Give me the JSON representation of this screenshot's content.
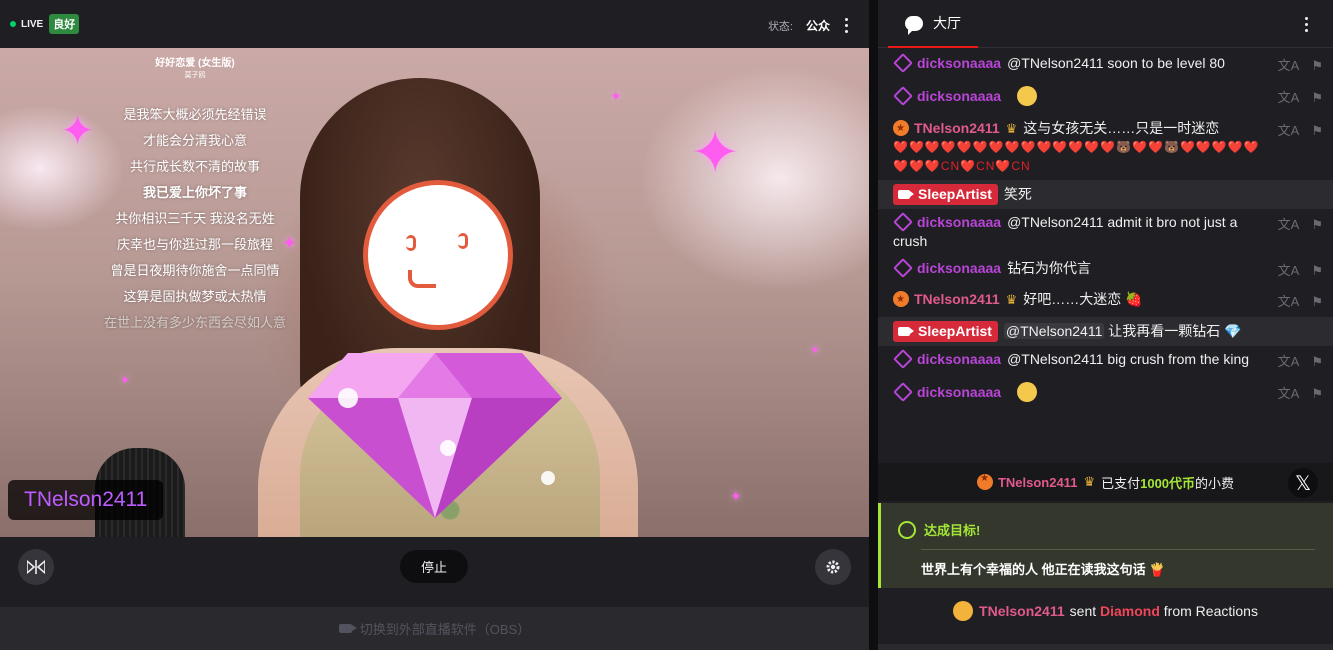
{
  "stream": {
    "live_label": "LIVE",
    "quality_label": "良好",
    "status_label": "状态:",
    "status_value": "公众",
    "overlay_username": "TNelson2411",
    "lyrics": {
      "title": "好好恋爱 (女生版)",
      "subtitle": "莫子鸥",
      "lines": [
        "是我笨大概必须先经错误",
        "才能会分清我心意",
        "共行成长数不清的故事",
        "我已爱上你坏了事",
        "共你相识三千天 我没名无姓",
        "庆幸也与你逛过那一段旅程",
        "曾是日夜期待你施舍一点同情",
        "这算是固执做梦或太热情",
        "在世上没有多少东西会尽如人意"
      ]
    },
    "stop_label": "停止",
    "obs_label": "切换到外部直播软件（OBS）"
  },
  "chat": {
    "tab_label": "大厅",
    "messages": [
      {
        "user": "dicksonaaaa",
        "text": "@TNelson2411  soon to be level 80"
      },
      {
        "user": "dicksonaaaa",
        "text": ""
      },
      {
        "user": "TNelson2411",
        "text": "这与女孩无关……只是一时迷恋",
        "emotes": "❤️❤️❤️❤️❤️❤️❤️❤️❤️❤️❤️❤️❤️❤️🐻❤️❤️🐻❤️❤️❤️❤️❤️❤️❤️❤️CN❤️CN❤️CN"
      },
      {
        "user": "SleepArtist",
        "text": "笑死"
      },
      {
        "user": "dicksonaaaa",
        "text": "@TNelson2411  admit it bro not just a crush"
      },
      {
        "user": "dicksonaaaa",
        "text": "钻石为你代言"
      },
      {
        "user": "TNelson2411",
        "text": "好吧……大迷恋 🍓"
      },
      {
        "user": "SleepArtist",
        "mention": "@TNelson2411",
        "text": "让我再看一颗钻石 💎"
      },
      {
        "user": "dicksonaaaa",
        "text": "@TNelson2411  big crush from the king"
      },
      {
        "user": "dicksonaaaa",
        "text": ""
      }
    ],
    "tip": {
      "user": "TNelson2411",
      "pre": "已支付",
      "amount": "1000代币",
      "post": "的小费",
      "close": "𝕏"
    },
    "goal": {
      "title": "达成目标!",
      "text": "世界上有个幸福的人 他正在读我这句话 🍟"
    },
    "reaction": {
      "user": "TNelson2411",
      "sent": "sent",
      "item": "Diamond",
      "from": "from Reactions"
    }
  },
  "colors": {
    "accent_red": "#e91916",
    "goal_green": "#a3e635",
    "username_purple": "#b845d6",
    "username_pink": "#e05a8c"
  }
}
